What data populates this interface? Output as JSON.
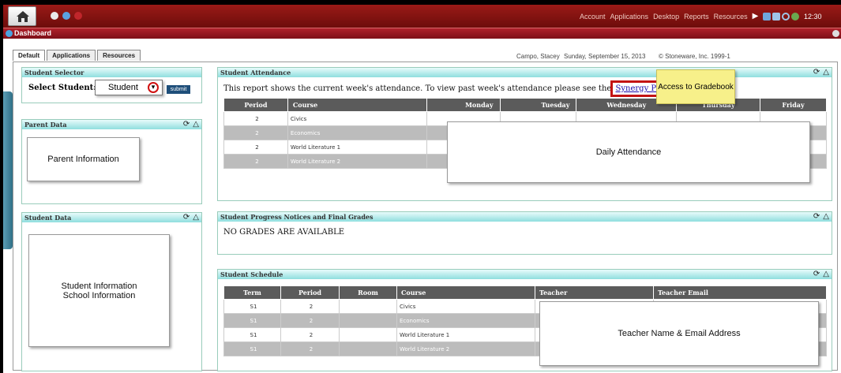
{
  "topbar": {
    "menu": [
      "Account",
      "Applications",
      "Desktop",
      "Reports",
      "Resources"
    ],
    "clock": "12:30"
  },
  "window": {
    "title": "Dashboard"
  },
  "tabs": [
    {
      "label": "Default"
    },
    {
      "label": "Applications"
    },
    {
      "label": "Resources"
    }
  ],
  "header_info": {
    "user": "Campo, Stacey",
    "date": "Sunday, September 15, 2013",
    "copyright": "© Stoneware, Inc. 1999-1"
  },
  "student_selector": {
    "title": "Student Selector",
    "label": "Select Student:",
    "value": "Student",
    "submit": "submit"
  },
  "parent_data": {
    "title": "Parent Data",
    "box": "Parent Information"
  },
  "student_data": {
    "title": "Student Data",
    "box_line1": "Student Information",
    "box_line2": "School Information"
  },
  "attendance": {
    "title": "Student Attendance",
    "intro": "This report shows the current week's attendance. To view past week's attendance please see the",
    "link": "Synergy Parent Portal",
    "callout": "Access to Gradebook",
    "overlay": "Daily Attendance",
    "columns": [
      "Period",
      "Course",
      "Monday",
      "Tuesday",
      "Wednesday",
      "Thursday",
      "Friday"
    ],
    "rows": [
      [
        "2",
        "Civics"
      ],
      [
        "2",
        "Economics"
      ],
      [
        "2",
        "World Literature 1"
      ],
      [
        "2",
        "World Literature 2"
      ]
    ]
  },
  "progress": {
    "title": "Student Progress Notices and Final Grades",
    "message": "NO GRADES ARE AVAILABLE"
  },
  "schedule": {
    "title": "Student Schedule",
    "overlay": "Teacher Name & Email Address",
    "columns": [
      "Term",
      "Period",
      "Room",
      "Course",
      "Teacher",
      "Teacher Email"
    ],
    "rows": [
      [
        "S1",
        "2",
        "",
        "Civics"
      ],
      [
        "S1",
        "2",
        "",
        "Economics"
      ],
      [
        "S1",
        "2",
        "",
        "World Literature 1"
      ],
      [
        "S1",
        "2",
        "",
        "World Literature 2"
      ]
    ]
  },
  "colors": {
    "topbar": "#8b1412",
    "panel_header": "#8fdede",
    "table_header": "#5b5b5b",
    "highlight": "#cc1111",
    "callout": "#f7f08a"
  }
}
